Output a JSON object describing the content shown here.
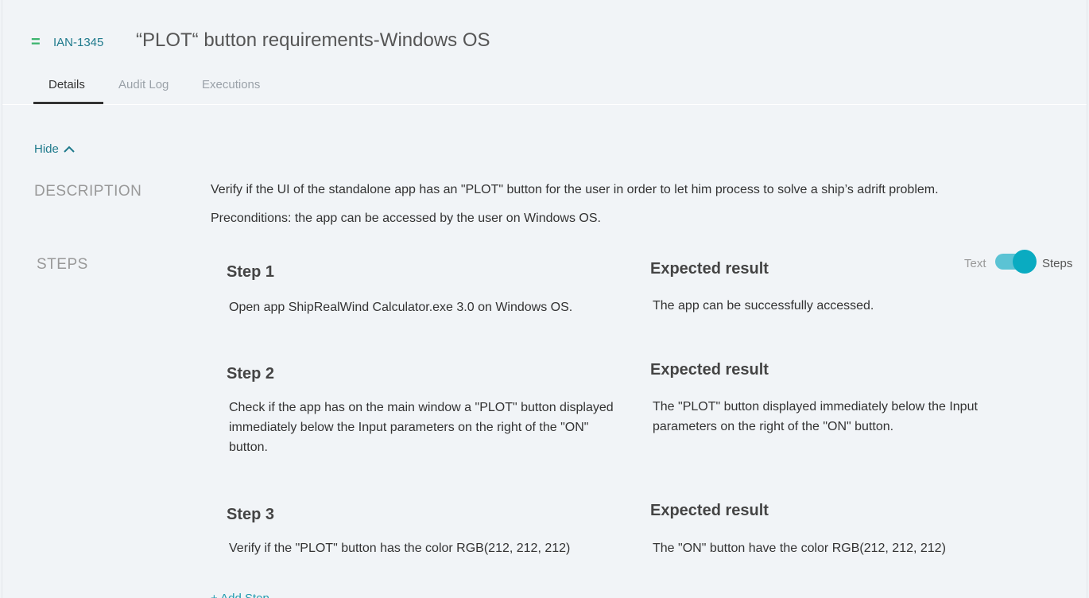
{
  "header": {
    "issue_key": "IAN-1345",
    "title": "“PLOT“ button requirements-Windows OS",
    "type_icon": "equals-icon"
  },
  "tabs": [
    {
      "label": "Details",
      "active": true
    },
    {
      "label": "Audit Log"
    },
    {
      "label": "Executions"
    }
  ],
  "hide_label": "Hide",
  "description": {
    "label": "DESCRIPTION",
    "lines": [
      "Verify if the UI of the standalone app has an \"PLOT\" button for the user in order to let him process to solve a ship’s adrift problem.",
      "Preconditions: the app can be accessed by the user on Windows OS."
    ]
  },
  "steps": {
    "label": "STEPS",
    "toggle": {
      "left": "Text",
      "right": "Steps",
      "on": true,
      "color": "#0aabc1"
    },
    "items": [
      {
        "title": "Step 1",
        "action": "Open app ShipRealWind Calculator.exe 3.0 on Windows OS.",
        "result_label": "Expected result",
        "result": "The app can be successfully accessed."
      },
      {
        "title": "Step 2",
        "action": "Check if the app has on the main window a \"PLOT\" button displayed immediately below the Input parameters on the right of the \"ON\" button.",
        "result_label": "Expected result",
        "result": "The \"PLOT\" button displayed immediately below the Input parameters on the right of the \"ON\" button."
      },
      {
        "title": "Step 3",
        "action": "Verify if the \"PLOT\" button has the color RGB(212, 212, 212)",
        "result_label": "Expected result",
        "result": "The \"ON\" button have the color RGB(212, 212, 212)"
      }
    ],
    "add_label": "+ Add Step"
  }
}
